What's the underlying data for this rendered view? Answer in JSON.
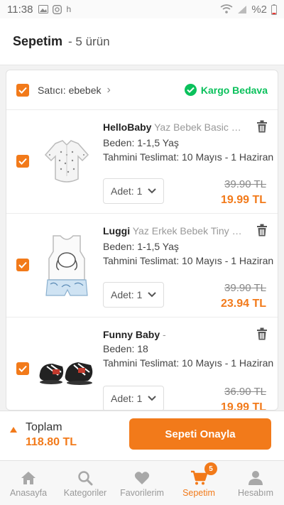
{
  "status_bar": {
    "time": "11:38",
    "h_label": "h",
    "battery": "%2"
  },
  "header": {
    "title": "Sepetim",
    "count": "- 5 ürün"
  },
  "seller": {
    "label": "Satıcı:",
    "name": "ebebek",
    "cargo": "Kargo Bedava"
  },
  "items": [
    {
      "brand": "HelloBaby",
      "product": "Yaz Bebek Basic Gö...",
      "size": "Beden: 1-1,5 Yaş",
      "delivery": "Tahmini Teslimat: 10 Mayıs - 1 Haziran",
      "qty": "Adet: 1",
      "old_price": "39.90 TL",
      "new_price": "19.99 TL"
    },
    {
      "brand": "Luggi",
      "product": "Yaz Erkek Bebek Tiny Ele...",
      "size": "Beden: 1-1,5 Yaş",
      "delivery": "Tahmini Teslimat: 10 Mayıs - 1 Haziran",
      "qty": "Adet: 1",
      "old_price": "39.90 TL",
      "new_price": "23.94 TL"
    },
    {
      "brand": "Funny Baby",
      "product": "-",
      "size": "Beden: 18",
      "delivery": "Tahmini Teslimat: 10 Mayıs - 1 Haziran",
      "qty": "Adet: 1",
      "old_price": "36.90 TL",
      "new_price": "19.99 TL"
    }
  ],
  "footer": {
    "total_label": "Toplam",
    "total_value": "118.80 TL",
    "confirm_label": "Sepeti Onayla"
  },
  "nav": {
    "items": [
      {
        "label": "Anasayfa",
        "icon": "home-icon"
      },
      {
        "label": "Kategoriler",
        "icon": "search-icon"
      },
      {
        "label": "Favorilerim",
        "icon": "heart-icon"
      },
      {
        "label": "Sepetim",
        "icon": "cart-icon",
        "badge": "5"
      },
      {
        "label": "Hesabım",
        "icon": "user-icon"
      }
    ]
  },
  "colors": {
    "accent": "#f27a1a",
    "success": "#0bc15c"
  }
}
